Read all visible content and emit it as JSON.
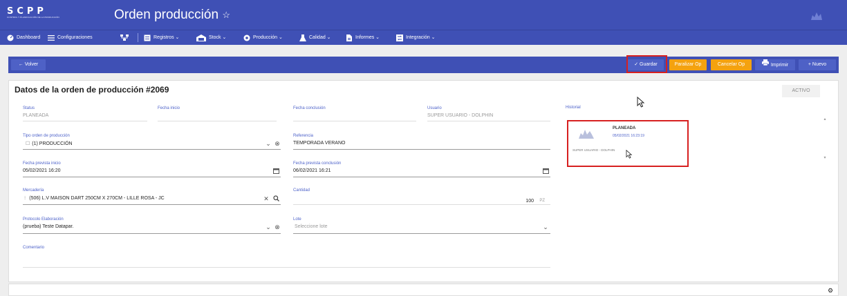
{
  "app": {
    "logo_text": "SCPP",
    "logo_subtext": "CONTROL Y PLANIFICACIÓN DE LA PRODUCCIÓN",
    "title": "Orden producción",
    "title_star": "☆"
  },
  "nav": {
    "items": [
      {
        "label": "Dashboard",
        "icon": "dashboard-icon"
      },
      {
        "label": "Configuraciones",
        "icon": "settings-icon"
      },
      {
        "label": "",
        "icon": "hierarchy-icon"
      },
      {
        "label": "Registros ⌄",
        "icon": "registros-icon"
      },
      {
        "label": "Stock ⌄",
        "icon": "stock-icon"
      },
      {
        "label": "Producción ⌄",
        "icon": "production-icon"
      },
      {
        "label": "Calidad ⌄",
        "icon": "quality-icon"
      },
      {
        "label": "Informes ⌄",
        "icon": "reports-icon"
      },
      {
        "label": "Integración ⌄",
        "icon": "integration-icon"
      }
    ]
  },
  "actions": {
    "back": "← Volver",
    "save": "✓ Guardar",
    "pause": "Paralizar Op",
    "cancel": "Cancelar Op",
    "print": "Imprimir",
    "new": "+ Nuevo"
  },
  "form": {
    "title": "Datos de la orden de producción #2069",
    "status_badge": "ACTIVO",
    "status": {
      "label": "Status",
      "value": "PLANEADA"
    },
    "fecha_inicio": {
      "label": "Fecha inicio",
      "value": ""
    },
    "fecha_conclusion": {
      "label": "Fecha conclusión",
      "value": ""
    },
    "usuario": {
      "label": "Usuario",
      "value": "SUPER USUARIO - DOLPHIN"
    },
    "tipo_orden": {
      "label": "Tipo orden de producción",
      "value": "(1) PRODUCCIÓN"
    },
    "referencia": {
      "label": "Referencia",
      "value": "TEMPORADA VERANO"
    },
    "fecha_prevista_inicio": {
      "label": "Fecha prevista inicio",
      "value": "05/02/2021 16:20"
    },
    "fecha_prevista_conclusion": {
      "label": "Fecha prevista conclusión",
      "value": "06/02/2021 16:21"
    },
    "mercaderia": {
      "label": "Mercadería",
      "value": "(506) L.V MAISON DART 250CM X 270CM - LILLE ROSA - JC"
    },
    "cantidad": {
      "label": "Cantidad",
      "value": "100",
      "unit": "PZ"
    },
    "protocolo": {
      "label": "Protocolo Elaboración",
      "value": "(prueba) Teste Datapar."
    },
    "lote": {
      "label": "Lote",
      "placeholder": "Seleccione lote"
    },
    "comentario": {
      "label": "Comentario",
      "value": ""
    }
  },
  "historial": {
    "label": "Historial",
    "entries": [
      {
        "status": "PLANEADA",
        "datetime": "05/02/2021 16:23:19",
        "user": "SUPER USUARIO - DOLPHIN"
      }
    ]
  },
  "colors": {
    "primary": "#3f50b5",
    "accent_orange": "#f4a20f",
    "highlight_red": "#d71f1f",
    "label_blue": "#4c61c9"
  }
}
